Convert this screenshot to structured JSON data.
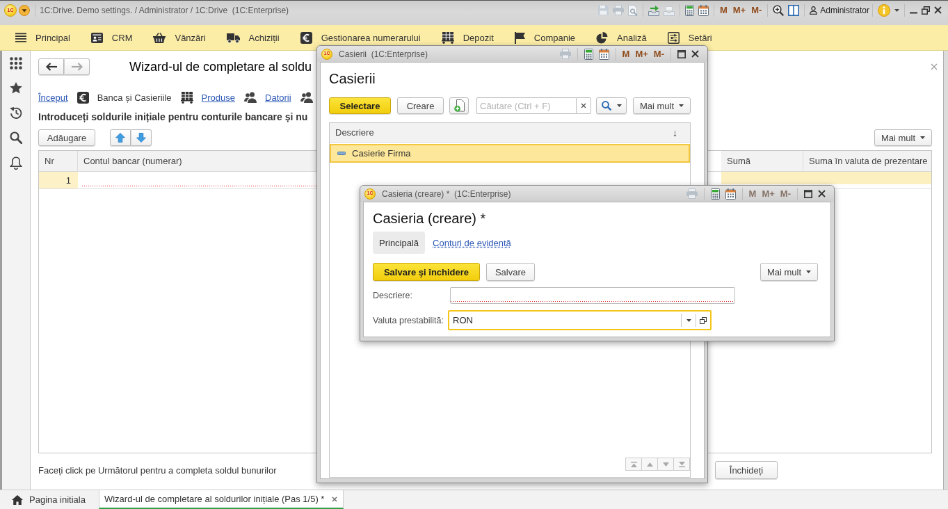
{
  "window": {
    "logo": "1C",
    "title": "1C:Drive. Demo settings. / Administrator / 1C:Drive  (1C:Enterprise)",
    "memory_buttons": [
      {
        "label": "M",
        "disabled": false
      },
      {
        "label": "M+",
        "disabled": false
      },
      {
        "label": "M-",
        "disabled": false
      }
    ],
    "user": "Administrator"
  },
  "sections": [
    "Principal",
    "CRM",
    "Vânzări",
    "Achiziții",
    "Gestionarea numerarului",
    "Depozit",
    "Companie",
    "Analiză",
    "Setări"
  ],
  "wizard": {
    "title": "Wizard-ul de completare al soldu",
    "steps": [
      {
        "label": "Început",
        "selected": false
      },
      {
        "label": "Banca și Casieriile",
        "selected": true
      },
      {
        "label": "Produse",
        "selected": false
      },
      {
        "label": "Datorii",
        "selected": false
      }
    ],
    "instruction": "Introduceți soldurile inițiale pentru conturile bancare și nu",
    "add_button": "Adăugare",
    "more_button": "Mai mult",
    "table": {
      "columns": [
        "Nr",
        "Contul bancar (numerar)",
        "Sumă",
        "Suma în valuta de prezentare"
      ],
      "rows": [
        {
          "nr": "1",
          "selected": true,
          "account_required": true
        }
      ]
    },
    "hint": "Faceți click pe Următorul pentru a completa soldul bunurilor",
    "close_button": "Închideți"
  },
  "tabs": [
    {
      "kind": "home",
      "label": "Pagina initiala",
      "selected": false,
      "closable": false
    },
    {
      "kind": "form",
      "label": "Wizard-ul de completare al soldurilor inițiale (Pas 1/5) *",
      "selected": true,
      "closable": true
    }
  ],
  "list_dialog": {
    "logo": "1C",
    "caption": "Casierii  (1C:Enterprise)",
    "memory_buttons": [
      {
        "label": "M",
        "disabled": false
      },
      {
        "label": "M+",
        "disabled": false
      },
      {
        "label": "M-",
        "disabled": false
      }
    ],
    "title": "Casierii",
    "select_button": "Selectare",
    "create_button": "Creare",
    "search": {
      "placeholder": "Căutare (Ctrl + F)"
    },
    "more_button": "Mai mult",
    "columns": [
      {
        "label": "Descriere",
        "sort_mark": "↓"
      }
    ],
    "rows": [
      {
        "label": "Casierie Firma",
        "selected": true
      }
    ]
  },
  "edit_dialog": {
    "logo": "1C",
    "caption": "Casieria (creare) *  (1C:Enterprise)",
    "memory_buttons": [
      {
        "label": "M",
        "disabled": true
      },
      {
        "label": "M+",
        "disabled": true
      },
      {
        "label": "M-",
        "disabled": true
      }
    ],
    "title": "Casieria (creare) *",
    "tabs": [
      {
        "label": "Principală",
        "selected": true
      },
      {
        "label": "Conturi de evidență",
        "selected": false
      }
    ],
    "save_close_button": "Salvare şi închidere",
    "save_button": "Salvare",
    "more_button": "Mai mult",
    "fields": [
      {
        "kind": "text",
        "label": "Descriere:",
        "required": true,
        "focused": false
      },
      {
        "kind": "select",
        "label": "Valuta prestabilită:",
        "value": "RON",
        "required": false,
        "focused": true
      }
    ]
  }
}
